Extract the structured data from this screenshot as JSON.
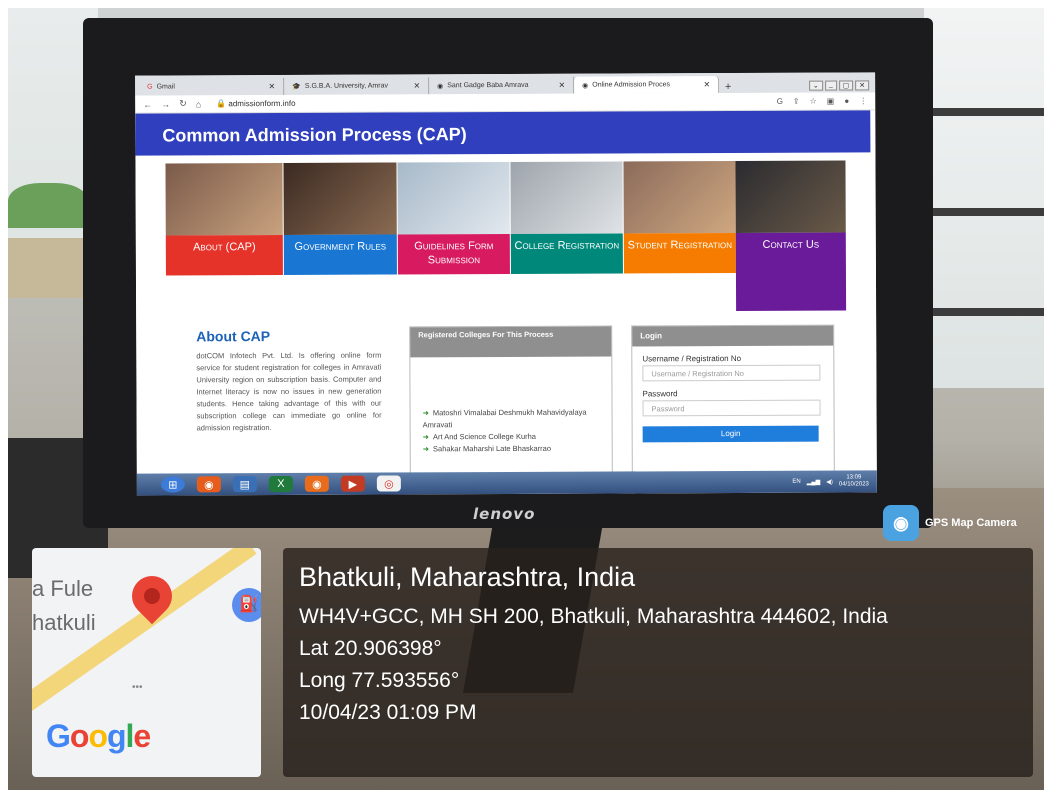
{
  "browser": {
    "tabs": [
      {
        "label": "Gmail",
        "icon": "gmail-icon"
      },
      {
        "label": "S.G.B.A. University, Amrav",
        "icon": "university-icon"
      },
      {
        "label": "Sant Gadge Baba Amrava",
        "icon": "globe-icon"
      },
      {
        "label": "Online Admission Proces",
        "icon": "globe-icon",
        "active": true
      }
    ],
    "url": "admissionform.info"
  },
  "site": {
    "title": "Common Admission Process (CAP)",
    "nav": [
      {
        "label": "About (CAP)",
        "color": "#e6332a"
      },
      {
        "label": "Government Rules",
        "color": "#1976d2"
      },
      {
        "label": "Guidelines Form Submission",
        "color": "#d81b60"
      },
      {
        "label": "College Registration",
        "color": "#00897b"
      },
      {
        "label": "Student Registration",
        "color": "#f57c00"
      },
      {
        "label": "Contact Us",
        "color": "#6a1b9a"
      }
    ],
    "about": {
      "title": "About CAP",
      "text": "dotCOM Infotech Pvt. Ltd. Is offering online form service for student registration for colleges in Amravati University region on subscription basis. Computer and Internet literacy is now no issues in new generation students. Hence taking advantage of this with our subscription college can immediate go online for admission registration."
    },
    "colleges": {
      "title": "Registered Colleges For This Process",
      "items": [
        "Matoshri Vimalabai Deshmukh Mahavidyalaya Amravati",
        "Art And Science College Kurha",
        "Sahakar Maharshi Late Bhaskarrao"
      ]
    },
    "login": {
      "title": "Login",
      "username_label": "Username / Registration No",
      "username_placeholder": "Username / Registration No",
      "password_label": "Password",
      "password_placeholder": "Password",
      "button": "Login"
    }
  },
  "taskbar": {
    "lang": "EN",
    "time": "13:09",
    "date": "04/10/2023"
  },
  "monitor_brand": "lenovo",
  "gps": {
    "app": "GPS Map Camera",
    "map_labels": [
      "a Fule",
      "hatkuli"
    ],
    "map_logo": "Google",
    "place": "Bhatkuli, Maharashtra, India",
    "address": "WH4V+GCC, MH SH 200, Bhatkuli, Maharashtra 444602, India",
    "lat": "Lat 20.906398°",
    "long": "Long 77.593556°",
    "datetime": "10/04/23 01:09 PM"
  }
}
